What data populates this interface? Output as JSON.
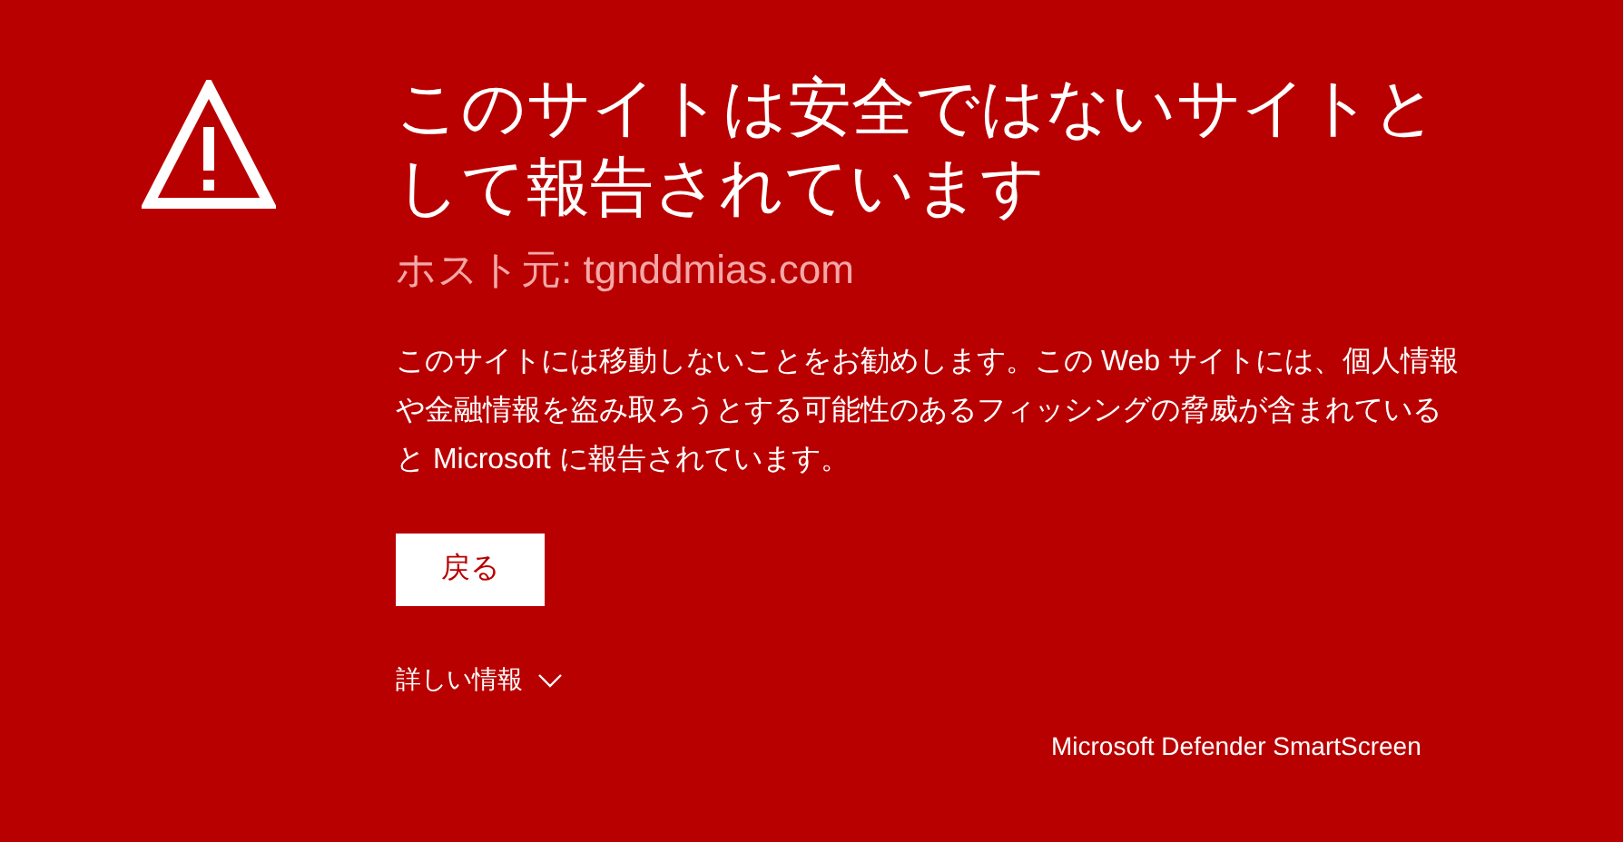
{
  "warning": {
    "title": "このサイトは安全ではないサイトとして報告されています",
    "host": "ホスト元: tgnddmias.com",
    "message": "このサイトには移動しないことをお勧めします。この Web サイトには、個人情報や金融情報を盗み取ろうとする可能性のあるフィッシングの脅威が含まれていると Microsoft に報告されています。",
    "back_button": "戻る",
    "details": {
      "label": "詳しい情報",
      "expanded": false
    }
  },
  "footer": "Microsoft Defender SmartScreen"
}
